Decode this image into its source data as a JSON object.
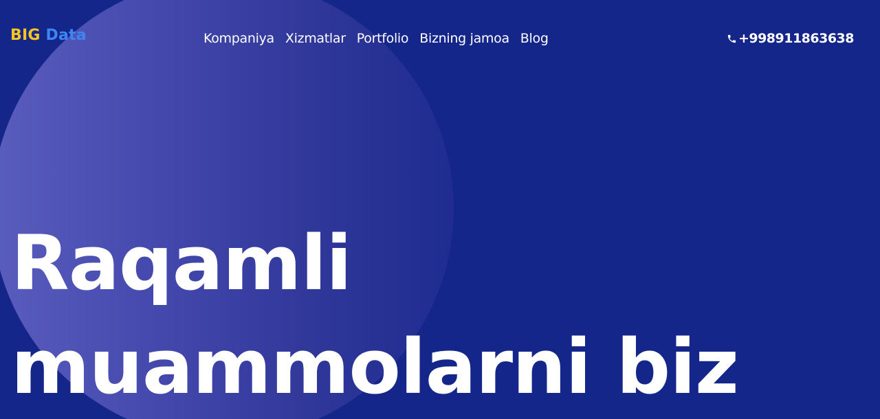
{
  "logo": {
    "part1": "BIG",
    "part2": "Data",
    "color_part1": "#f7c51d",
    "color_part2": "#3d86f2"
  },
  "nav": {
    "items": [
      {
        "label": "Kompaniya"
      },
      {
        "label": "Xizmatlar"
      },
      {
        "label": "Portfolio"
      },
      {
        "label": "Bizning jamoa"
      },
      {
        "label": "Blog"
      }
    ]
  },
  "contact": {
    "phone": "+998911863638",
    "icon": "phone-icon"
  },
  "hero": {
    "line1": "Raqamli",
    "line2": "muammolarni biz"
  },
  "colors": {
    "background": "#15268a",
    "circle_light": "#5a5dbd",
    "text": "#ffffff"
  }
}
